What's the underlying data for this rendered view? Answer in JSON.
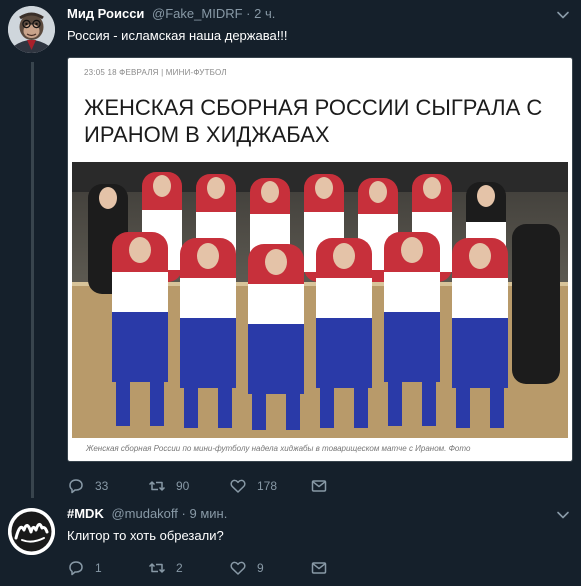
{
  "tweet1": {
    "display_name": "Мид Роисси",
    "handle": "@Fake_MIDRF",
    "separator": "·",
    "time": "2 ч.",
    "text": "Россия - исламская наша держава!!!",
    "media": {
      "meta": "23:05 18 ФЕВРАЛЯ | МИНИ-ФУТБОЛ",
      "headline": "ЖЕНСКАЯ СБОРНАЯ РОССИИ СЫГРАЛА С ИРАНОМ В ХИДЖАБАХ",
      "caption": "Женская сборная России по мини-футболу надела хиджабы в товарищеском матче с Ираном. Фото"
    },
    "actions": {
      "replies": "33",
      "retweets": "90",
      "likes": "178"
    }
  },
  "tweet2": {
    "display_name": "#MDK",
    "handle": "@mudakoff",
    "separator": "·",
    "time": "9 мин.",
    "text": "Клитор то хоть обрезали?",
    "actions": {
      "replies": "1",
      "retweets": "2",
      "likes": "9"
    }
  },
  "colors": {
    "background": "#15202b",
    "secondary_text": "#8899a6",
    "divider": "#38444d"
  },
  "icons": [
    "avatar-ape",
    "chevron-down-icon",
    "reply-icon",
    "retweet-icon",
    "like-icon",
    "message-icon",
    "mdk-logo"
  ]
}
